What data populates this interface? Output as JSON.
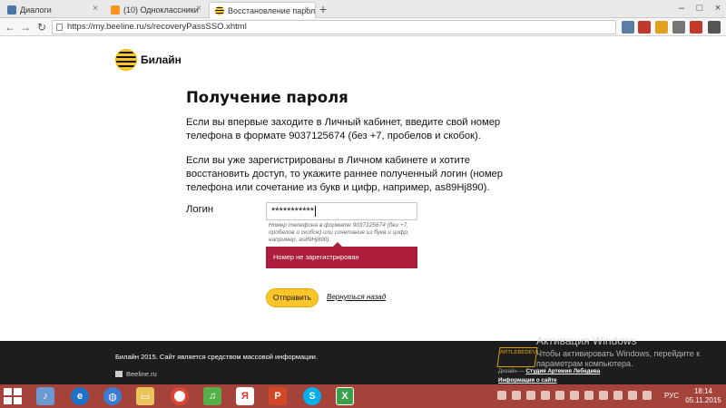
{
  "browser": {
    "tabs": [
      {
        "label": "Диалоги",
        "active": false
      },
      {
        "label": "(10) Одноклассники",
        "active": false
      },
      {
        "label": "Восстановление пароля",
        "active": true
      }
    ],
    "url": "https://my.beeline.ru/s/recoveryPassSSO.xhtml"
  },
  "page": {
    "logo_text": "Билайн",
    "title": "Получение пароля",
    "para1": "Если вы впервые заходите в Личный кабинет, введите свой номер телефона в формате 9037125674 (без +7, пробелов и скобок).",
    "para2": "Если вы уже зарегистрированы в Личном кабинете и хотите восстановить доступ, то укажите раннее полученный логин (номер телефона или сочетание из букв и цифр, например, as89Hj890).",
    "login_label": "Логин",
    "login_value": "***********",
    "hint": "Номер телефона в формате 9037125674 (без +7, пробелов и скобок) или сочетание из букв и цифр, например, as89Hj890).",
    "error": "Номер не зарегистрирован",
    "submit": "Отправить",
    "back": "Вернуться назад"
  },
  "footer": {
    "copyright": "Билайн 2015. Сайт является средством массовой информации.",
    "site_link": "Beeline.ru",
    "studio_logo": "ARTLEBEDEV",
    "design_prefix": "Дизайн —",
    "design_link": "Студия Артемия Лебедева",
    "site_info": "Информация о сайте"
  },
  "watermark": {
    "title": "Активация Windows",
    "body": "Чтобы активировать Windows, перейдите к параметрам компьютера."
  },
  "taskbar": {
    "lang": "РУС",
    "time": "18:14",
    "date": "05.11.2015"
  },
  "colors": {
    "accent_yellow": "#fdc52a",
    "error_red": "#ac1d3b",
    "taskbar": "#a4433a",
    "footer": "#1d1d1d"
  }
}
